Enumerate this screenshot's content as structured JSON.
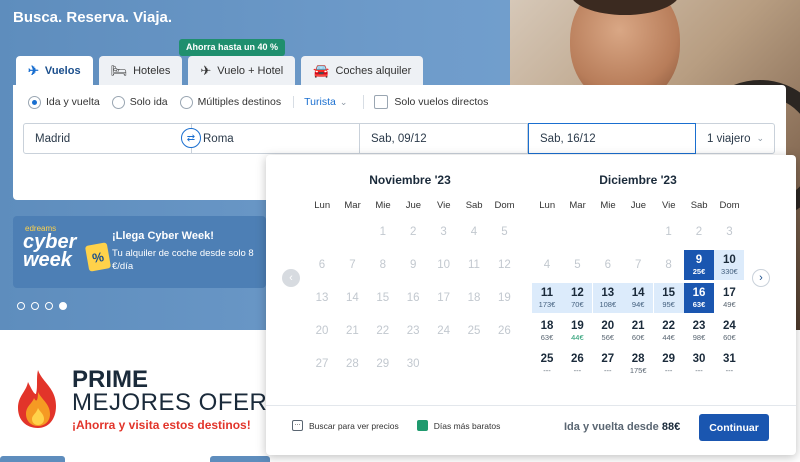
{
  "hero": {
    "title": "Busca. Reserva. Viaja."
  },
  "promo_badge": "Ahorra hasta un 40 %",
  "tabs": [
    {
      "label": "Vuelos",
      "icon": "plane-icon",
      "active": true
    },
    {
      "label": "Hoteles",
      "icon": "bed-icon",
      "active": false
    },
    {
      "label": "Vuelo + Hotel",
      "icon": "plane-bed-icon",
      "active": false
    },
    {
      "label": "Coches alquiler",
      "icon": "car-icon",
      "active": false
    }
  ],
  "trip_options": {
    "round_trip": "Ida y vuelta",
    "one_way": "Solo ida",
    "multi": "Múltiples destinos",
    "selected": "round_trip",
    "cabin": "Turista",
    "direct_only": "Solo vuelos directos"
  },
  "search": {
    "origin": "Madrid",
    "destination": "Roma",
    "depart": "Sab, 09/12",
    "return": "Sab, 16/12",
    "travellers": "1 viajero"
  },
  "banner": {
    "brand": "edreams",
    "logo_line1": "cyber",
    "logo_line2": "week",
    "logo_pct": "%",
    "title": "¡Llega Cyber Week!",
    "subtitle": "Tu alquiler de coche desde solo 8 €/día"
  },
  "carousel": {
    "count": 4,
    "active": 4
  },
  "prime": {
    "line1": "PRIME",
    "line2": "MEJORES OFERTAS",
    "line3": "¡Ahorra y visita estos destinos!"
  },
  "calendar": {
    "weekdays": [
      "Lun",
      "Mar",
      "Mie",
      "Jue",
      "Vie",
      "Sab",
      "Dom"
    ],
    "months": [
      {
        "title": "Noviembre '23",
        "days": [
          [
            null,
            null,
            "1",
            "2",
            "3",
            "4",
            "5"
          ],
          [
            "6",
            "7",
            "8",
            "9",
            "10",
            "11",
            "12"
          ],
          [
            "13",
            "14",
            "15",
            "16",
            "17",
            "18",
            "19"
          ],
          [
            "20",
            "21",
            "22",
            "23",
            "24",
            "25",
            "26"
          ],
          [
            "27",
            "28",
            "29",
            "30",
            null,
            null,
            null
          ]
        ]
      },
      {
        "title": "Diciembre '23",
        "days": [
          [
            null,
            null,
            null,
            null,
            "1",
            "2",
            "3"
          ],
          [
            "4",
            "5",
            "6",
            "7",
            "8",
            "9",
            "10"
          ],
          [
            "11",
            "12",
            "13",
            "14",
            "15",
            "16",
            "17"
          ],
          [
            "18",
            "19",
            "20",
            "21",
            "22",
            "23",
            "24"
          ],
          [
            "25",
            "26",
            "27",
            "28",
            "29",
            "30",
            "31"
          ]
        ],
        "prices": {
          "9": "25€",
          "10": "330€",
          "11": "173€",
          "12": "70€",
          "13": "108€",
          "14": "94€",
          "15": "95€",
          "16": "63€",
          "17": "49€",
          "18": "63€",
          "19": "44€",
          "20": "56€",
          "21": "60€",
          "22": "44€",
          "23": "98€",
          "24": "60€",
          "25": "---",
          "26": "---",
          "27": "---",
          "28": "175€",
          "29": "---",
          "30": "---",
          "31": "---"
        },
        "cheap_days": [
          "19"
        ],
        "past_until": 8,
        "selected": [
          "9",
          "16"
        ],
        "range": [
          "10",
          "11",
          "12",
          "13",
          "14",
          "15"
        ]
      }
    ],
    "legend_search": "Buscar para ver precios",
    "legend_cheap": "Días más baratos",
    "legend_search_glyph": "...",
    "summary_label": "Ida y vuelta desde",
    "summary_price": "88€",
    "continue": "Continuar",
    "prev_glyph": "‹",
    "next_glyph": "›"
  },
  "colors": {
    "primary": "#1a56b0",
    "accent": "#1a6fd0",
    "range": "#dcebfb",
    "cheap": "#1f9a6e",
    "promo": "#1f8f6e",
    "prime_red": "#e2342a"
  }
}
